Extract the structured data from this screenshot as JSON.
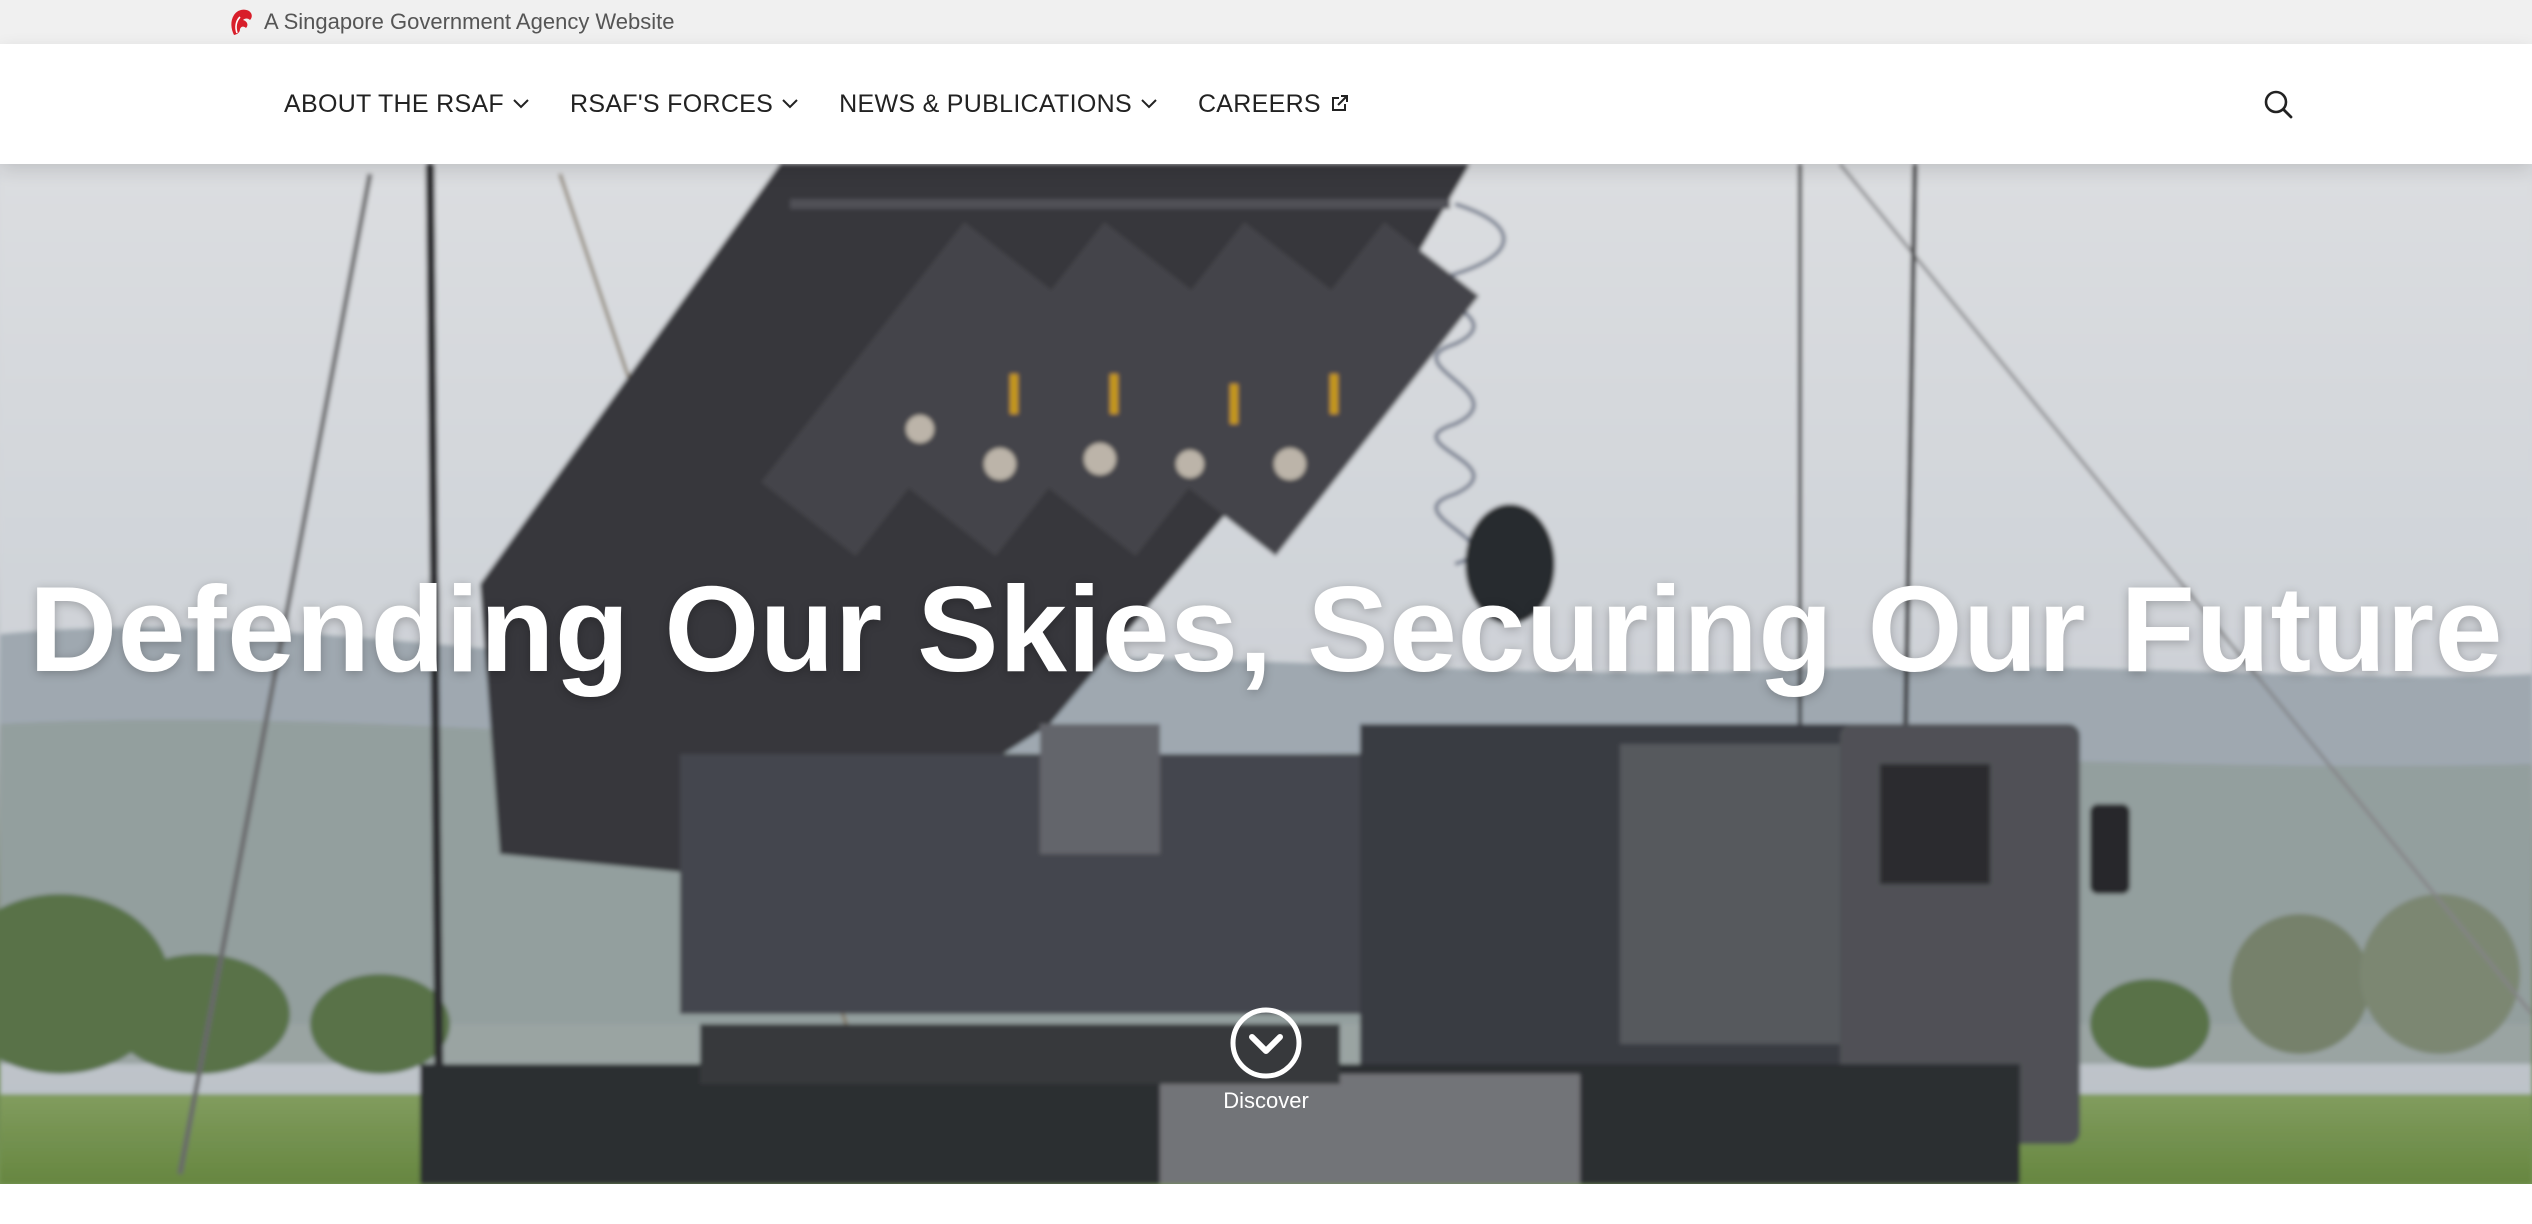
{
  "masthead": {
    "text": "A Singapore Government Agency Website",
    "icon": "lion-head-icon",
    "icon_color": "#d81e2a"
  },
  "nav": {
    "items": [
      {
        "label": "ABOUT THE RSAF",
        "icon": "chevron-down-icon"
      },
      {
        "label": "RSAF'S FORCES",
        "icon": "chevron-down-icon"
      },
      {
        "label": "NEWS & PUBLICATIONS",
        "icon": "chevron-down-icon"
      },
      {
        "label": "CAREERS",
        "icon": "external-link-icon"
      }
    ],
    "search_icon": "search-icon"
  },
  "hero": {
    "title": "Defending Our Skies, Securing Our Future",
    "discover_label": "Discover",
    "discover_icon": "chevron-circle-down-icon"
  },
  "colors": {
    "masthead_bg": "#f0f0f0",
    "header_bg": "#ffffff",
    "text": "#222222",
    "hero_text": "#ffffff"
  }
}
